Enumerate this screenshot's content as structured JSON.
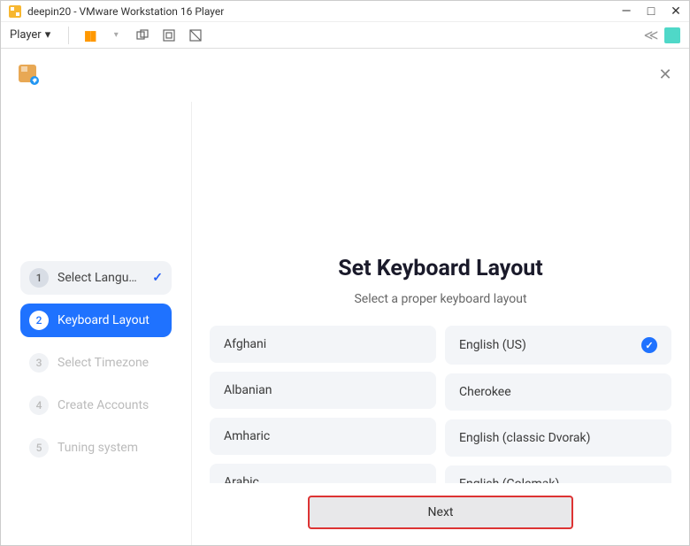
{
  "window": {
    "title": "deepin20 - VMware Workstation 16 Player"
  },
  "toolbar": {
    "player_label": "Player"
  },
  "installer": {
    "title": "Set Keyboard Layout",
    "subtitle": "Select a proper keyboard layout",
    "next_label": "Next",
    "steps": [
      {
        "num": "1",
        "label": "Select Langu…"
      },
      {
        "num": "2",
        "label": "Keyboard Layout"
      },
      {
        "num": "3",
        "label": "Select Timezone"
      },
      {
        "num": "4",
        "label": "Create Accounts"
      },
      {
        "num": "5",
        "label": "Tuning system"
      }
    ],
    "left_items": [
      {
        "label": "Afghani"
      },
      {
        "label": "Albanian"
      },
      {
        "label": "Amharic"
      },
      {
        "label": "Arabic"
      }
    ],
    "right_items": [
      {
        "label": "English (US)",
        "selected": true
      },
      {
        "label": "Cherokee"
      },
      {
        "label": "English (classic Dvorak)"
      },
      {
        "label": "English (Colemak)"
      }
    ]
  }
}
